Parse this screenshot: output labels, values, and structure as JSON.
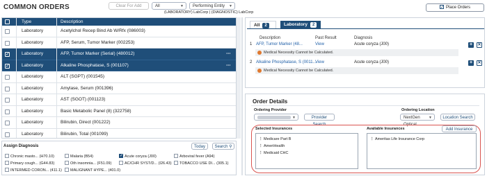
{
  "header": {
    "title": "COMMON ORDERS",
    "clear_btn": "Clear For Add",
    "filter_select": "All",
    "performing_select": "Performing Entity",
    "subheader": "(LABORATORY) LabCorp | (DIAGNOSTIC) LabCorp",
    "place_orders": "Place Orders"
  },
  "grid": {
    "columns": [
      "Type",
      "Description"
    ],
    "rows": [
      {
        "checked": false,
        "type": "Laboratory",
        "desc": "Acetylchol Recep Bind Ab W/Rfx (086003)",
        "selected": false
      },
      {
        "checked": false,
        "type": "Laboratory",
        "desc": "AFP, Serum, Tumor Marker (002253)",
        "selected": false
      },
      {
        "checked": true,
        "type": "Laboratory",
        "desc": "AFP, Tumor Marker (Serial) (480012)",
        "selected": true
      },
      {
        "checked": true,
        "type": "Laboratory",
        "desc": "Alkaline Phosphatase, S (001107)",
        "selected": true
      },
      {
        "checked": false,
        "type": "Laboratory",
        "desc": "ALT (SGPT) (001545)",
        "selected": false
      },
      {
        "checked": false,
        "type": "Laboratory",
        "desc": "Amylase, Serum (001396)",
        "selected": false
      },
      {
        "checked": false,
        "type": "Laboratory",
        "desc": "AST (SGOT) (001123)",
        "selected": false
      },
      {
        "checked": false,
        "type": "Laboratory",
        "desc": "Basic Metabolic Panel (8) (322758)",
        "selected": false
      },
      {
        "checked": false,
        "type": "Laboratory",
        "desc": "Bilirubin, Direct (001222)",
        "selected": false
      },
      {
        "checked": false,
        "type": "Laboratory",
        "desc": "Bilirubin, Total (001099)",
        "selected": false
      },
      {
        "checked": false,
        "type": "Laboratory",
        "desc": "Bilirubin, Total and Direct (...)",
        "selected": false
      }
    ],
    "row_menu": "⋯"
  },
  "diagnosis": {
    "title": "Assign Diagnosis",
    "today_btn": "Today",
    "search_btn": "Search",
    "items": [
      {
        "label": "Chronic masto... (H70.10)",
        "checked": false
      },
      {
        "label": "Malaria (B54)",
        "checked": false
      },
      {
        "label": "Acute coryza (J00)",
        "checked": true
      },
      {
        "label": "Arboviral fever (A94)",
        "checked": false
      },
      {
        "label": "Primary cough... (G44.83)",
        "checked": false
      },
      {
        "label": "Oth insomnia... (F51.09)",
        "checked": false
      },
      {
        "label": "AC/CHR SYST/D... (I26.43)",
        "checked": false
      },
      {
        "label": "TOBACCO USE DI... (305.1)",
        "checked": false
      },
      {
        "label": "INTERMED CORON... (411.1)",
        "checked": false
      },
      {
        "label": "MALIGNANT HYPE... (401.0)",
        "checked": false
      }
    ]
  },
  "orders": {
    "tabs": [
      {
        "label": "All",
        "count": "2"
      },
      {
        "label": "Laboratory",
        "count": "2"
      }
    ],
    "columns": {
      "desc": "Description",
      "past": "Past Result",
      "dx": "Diagnosis"
    },
    "items": [
      {
        "num": "1",
        "desc": "AFP, Tumor Marker (48...",
        "view": "View",
        "dx": "Acute coryza (J00)",
        "warn": "Medical Necessity Cannot be Calculated."
      },
      {
        "num": "2",
        "desc": "Alkaline Phosphatase, S (0011...",
        "view": "View",
        "dx": "Acute coryza (J00)",
        "warn": "Medical Necessity Cannot be Calculated."
      }
    ]
  },
  "details": {
    "title": "Order Details",
    "ordering_provider_label": "Ordering Provider",
    "provider_search": "Provider Search",
    "ordering_location_label": "Ordering Location",
    "location_value": "NextGen Optical",
    "location_search": "Location Search",
    "selected_ins_label": "Selected Insurances",
    "available_ins_label": "Available Insurances",
    "add_insurance": "Add Insurance",
    "selected_insurances": [
      "Medicare Part B",
      "AmeriHealth",
      "Medicaid CHC"
    ],
    "available_insurances": [
      "Ameritas Life Insurance Corp"
    ]
  },
  "colors": {
    "primary": "#1f4e79",
    "warn_dot": "#e0792f",
    "highlight": "#d9534f"
  }
}
